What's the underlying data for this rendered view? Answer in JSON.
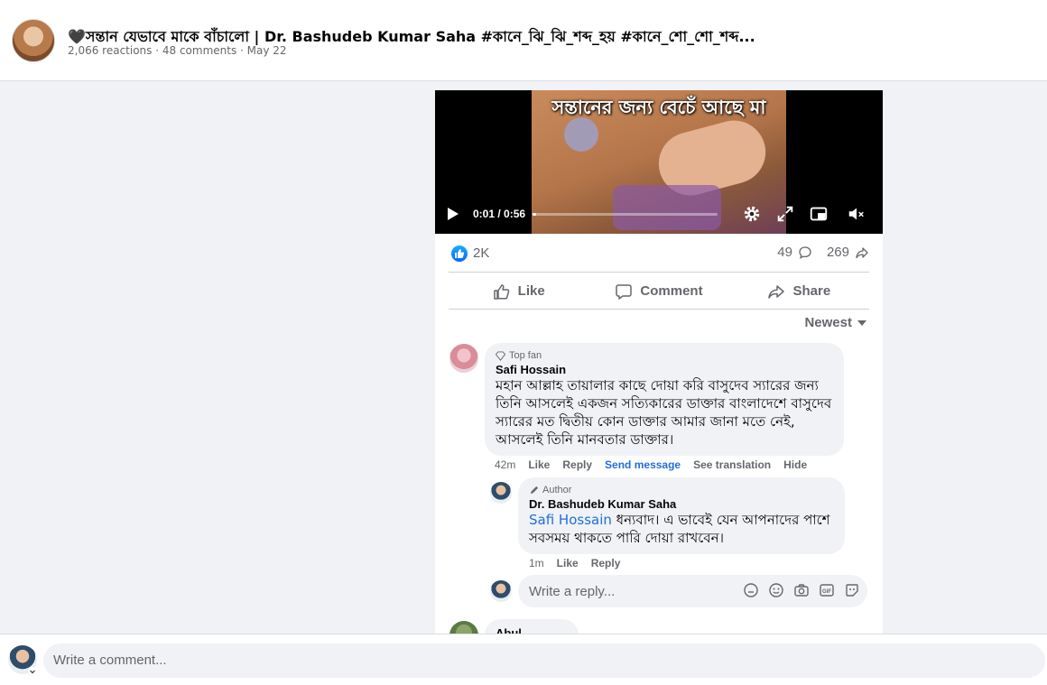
{
  "header": {
    "title": "🖤সন্তান যেভাবে মাকে বাঁচালো | Dr. Bashudeb Kumar Saha #কানে_ঝি_ঝি_শব্দ_হয় #কানে_শো_শো_শব্দ...",
    "subline": "2,066 reactions · 48 comments · May 22"
  },
  "video": {
    "caption": "সন্তানের জন্য বেচেঁ আছে মা",
    "time": "0:01 / 0:56",
    "progress_fraction": 0.02,
    "icons": [
      "play-icon",
      "settings-icon",
      "fullscreen-icon",
      "picture-in-picture-icon",
      "volume-muted-icon"
    ]
  },
  "stats": {
    "likes": "2K",
    "comments": "49",
    "shares": "269"
  },
  "actions": {
    "like": "Like",
    "comment": "Comment",
    "share": "Share"
  },
  "sort": {
    "label": "Newest"
  },
  "comments": [
    {
      "badge": "Top fan",
      "name": "Safi Hossain",
      "text": "মহান আল্লাহ তায়ালার কাছে দোয়া করি বাসুদেব স্যারের জন্য তিনি আসলেই একজন সত্যিকারের ডাক্তার বাংলাদেশে বাসুদেব স্যারের মত দ্বিতীয় কোন ডাক্তার আমার জানা মতে নেই, আসলেই তিনি মানবতার ডাক্তার।",
      "time": "42m",
      "like": "Like",
      "reply": "Reply",
      "send_message": "Send message",
      "see_translation": "See translation",
      "hide": "Hide"
    },
    {
      "badge": "Author",
      "name": "Dr. Bashudeb Kumar Saha",
      "mention": "Safi Hossain",
      "text": " ধন্যবাদ। এ ভাবেই যেন আপনাদের পাশে সবসময় থাকতে পারি দোয়া রাখবেন।",
      "time": "1m",
      "like": "Like",
      "reply": "Reply"
    },
    {
      "name": "Abul Hossain"
    }
  ],
  "reply_box": {
    "placeholder": "Write a reply..."
  },
  "composer": {
    "placeholder": "Write a comment..."
  },
  "colors": {
    "accent": "#0866ff",
    "link": "#216fdb",
    "text_secondary": "#65676b"
  }
}
